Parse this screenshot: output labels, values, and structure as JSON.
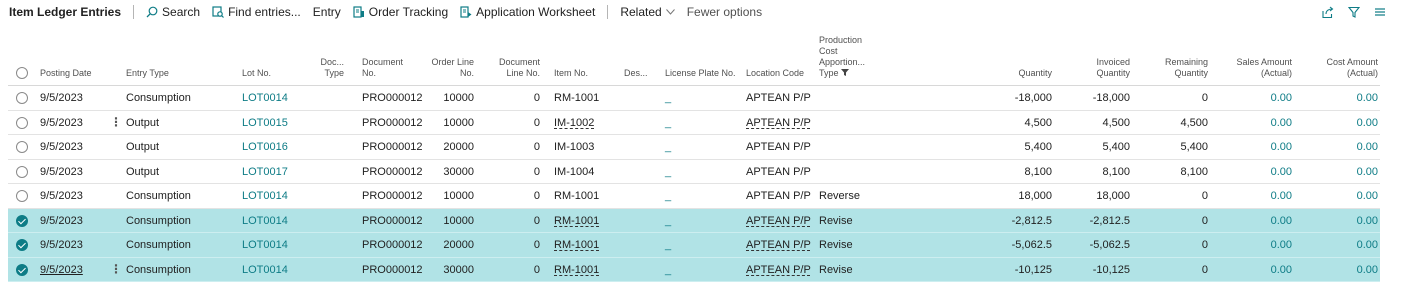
{
  "toolbar": {
    "title": "Item Ledger Entries",
    "search": "Search",
    "find_entries": "Find entries...",
    "entry": "Entry",
    "order_tracking": "Order Tracking",
    "application_worksheet": "Application Worksheet",
    "related": "Related",
    "fewer_options": "Fewer options"
  },
  "columns": {
    "posting_date": "Posting Date",
    "entry_type": "Entry Type",
    "lot_no": "Lot No.",
    "doc_type_1": "Doc...",
    "doc_type_2": "Type",
    "document_no_1": "Document",
    "document_no_2": "No.",
    "order_line_1": "Order Line",
    "order_line_2": "No.",
    "doc_line_1": "Document",
    "doc_line_2": "Line No.",
    "item_no": "Item No.",
    "description": "Des...",
    "license_plate": "License Plate No.",
    "location_code": "Location Code",
    "prod_cost_1": "Production",
    "prod_cost_2": "Cost",
    "prod_cost_3": "Apportion...",
    "prod_cost_4": "Type",
    "quantity": "Quantity",
    "invoiced_1": "Invoiced",
    "invoiced_2": "Quantity",
    "remaining_1": "Remaining",
    "remaining_2": "Quantity",
    "sales_1": "Sales Amount",
    "sales_2": "(Actual)",
    "cost_1": "Cost Amount",
    "cost_2": "(Actual)"
  },
  "rows": [
    {
      "selected": false,
      "kebab": false,
      "date": "9/5/2023",
      "entry_type": "Consumption",
      "lot": "LOT0014",
      "doc_no": "PRO000012",
      "order_line": "10000",
      "doc_line": "0",
      "item": "RM-1001",
      "lp": "_",
      "location": "APTEAN P/P",
      "prod_cost": "",
      "qty": "-18,000",
      "inv_qty": "-18,000",
      "rem_qty": "0",
      "sales": "0.00",
      "cost": "0.00"
    },
    {
      "selected": false,
      "kebab": true,
      "date": "9/5/2023",
      "entry_type": "Output",
      "lot": "LOT0015",
      "doc_no": "PRO000012",
      "order_line": "10000",
      "doc_line": "0",
      "item": "IM-1002",
      "lp": "_",
      "location": "APTEAN P/P",
      "prod_cost": "",
      "qty": "4,500",
      "inv_qty": "4,500",
      "rem_qty": "4,500",
      "sales": "0.00",
      "cost": "0.00"
    },
    {
      "selected": false,
      "kebab": false,
      "date": "9/5/2023",
      "entry_type": "Output",
      "lot": "LOT0016",
      "doc_no": "PRO000012",
      "order_line": "20000",
      "doc_line": "0",
      "item": "IM-1003",
      "lp": "_",
      "location": "APTEAN P/P",
      "prod_cost": "",
      "qty": "5,400",
      "inv_qty": "5,400",
      "rem_qty": "5,400",
      "sales": "0.00",
      "cost": "0.00"
    },
    {
      "selected": false,
      "kebab": false,
      "date": "9/5/2023",
      "entry_type": "Output",
      "lot": "LOT0017",
      "doc_no": "PRO000012",
      "order_line": "30000",
      "doc_line": "0",
      "item": "IM-1004",
      "lp": "_",
      "location": "APTEAN P/P",
      "prod_cost": "",
      "qty": "8,100",
      "inv_qty": "8,100",
      "rem_qty": "8,100",
      "sales": "0.00",
      "cost": "0.00"
    },
    {
      "selected": false,
      "kebab": false,
      "date": "9/5/2023",
      "entry_type": "Consumption",
      "lot": "LOT0014",
      "doc_no": "PRO000012",
      "order_line": "10000",
      "doc_line": "0",
      "item": "RM-1001",
      "lp": "_",
      "location": "APTEAN P/P",
      "prod_cost": "Reverse",
      "qty": "18,000",
      "inv_qty": "18,000",
      "rem_qty": "0",
      "sales": "0.00",
      "cost": "0.00"
    },
    {
      "selected": true,
      "kebab": false,
      "date": "9/5/2023",
      "entry_type": "Consumption",
      "lot": "LOT0014",
      "doc_no": "PRO000012",
      "order_line": "10000",
      "doc_line": "0",
      "item": "RM-1001",
      "lp": "_",
      "location": "APTEAN P/P",
      "prod_cost": "Revise",
      "qty": "-2,812.5",
      "inv_qty": "-2,812.5",
      "rem_qty": "0",
      "sales": "0.00",
      "cost": "0.00"
    },
    {
      "selected": true,
      "kebab": false,
      "date": "9/5/2023",
      "entry_type": "Consumption",
      "lot": "LOT0014",
      "doc_no": "PRO000012",
      "order_line": "20000",
      "doc_line": "0",
      "item": "RM-1001",
      "lp": "_",
      "location": "APTEAN P/P",
      "prod_cost": "Revise",
      "qty": "-5,062.5",
      "inv_qty": "-5,062.5",
      "rem_qty": "0",
      "sales": "0.00",
      "cost": "0.00"
    },
    {
      "selected": true,
      "kebab": true,
      "date": "9/5/2023",
      "entry_type": "Consumption",
      "lot": "LOT0014",
      "doc_no": "PRO000012",
      "order_line": "30000",
      "doc_line": "0",
      "item": "RM-1001",
      "lp": "_",
      "location": "APTEAN P/P",
      "prod_cost": "Revise",
      "qty": "-10,125",
      "inv_qty": "-10,125",
      "rem_qty": "0",
      "sales": "0.00",
      "cost": "0.00"
    }
  ],
  "icons": {
    "search": "search-icon",
    "find_entries": "find-entries-icon",
    "order_tracking": "order-tracking-icon",
    "application_worksheet": "worksheet-icon",
    "related_chevron": "chevron-down-icon",
    "share": "share-icon",
    "filter": "filter-icon",
    "list": "list-view-icon",
    "sort": "sort-filter-icon"
  },
  "colors": {
    "accent": "#0e7c86",
    "selected_row": "#b1e3e6"
  }
}
